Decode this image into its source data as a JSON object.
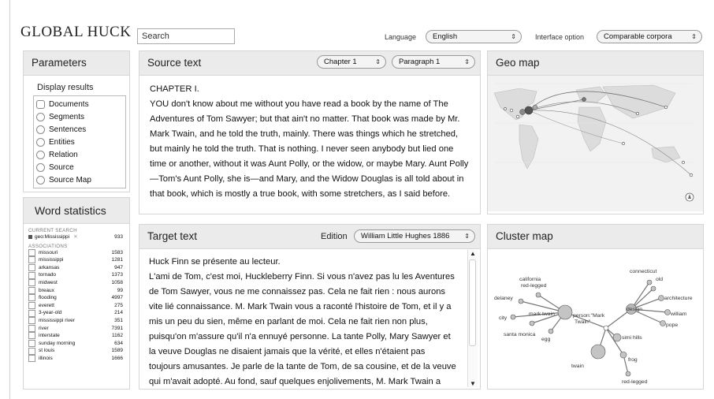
{
  "app": {
    "title": "GLOBAL HUCK"
  },
  "search": {
    "value": "Search"
  },
  "language": {
    "label": "Language",
    "value": "English"
  },
  "interface": {
    "label": "Interface option",
    "value": "Comparable corpora"
  },
  "parameters": {
    "title": "Parameters",
    "display_label": "Display results",
    "options": [
      "Documents",
      "Segments",
      "Sentences",
      "Entities",
      "Relation",
      "Source",
      "Source Map"
    ]
  },
  "word_stats": {
    "title": "Word statistics",
    "current_label": "CURRENT SEARCH",
    "current": {
      "term": "geo:Mississippi",
      "count": "933"
    },
    "assoc_label": "ASSOCIATIONS",
    "rows": [
      {
        "term": "missouri",
        "count": "1583"
      },
      {
        "term": "mississippi",
        "count": "1281"
      },
      {
        "term": "arkansas",
        "count": "947"
      },
      {
        "term": "tornado",
        "count": "1373"
      },
      {
        "term": "midwest",
        "count": "1058"
      },
      {
        "term": "breaux",
        "count": "99"
      },
      {
        "term": "flooding",
        "count": "4997"
      },
      {
        "term": "everett",
        "count": "275"
      },
      {
        "term": "3-year-old",
        "count": "214"
      },
      {
        "term": "mississippi river",
        "count": "351"
      },
      {
        "term": "river",
        "count": "7391"
      },
      {
        "term": "interstate",
        "count": "1162"
      },
      {
        "term": "sunday morning",
        "count": "634"
      },
      {
        "term": "st louis",
        "count": "1589"
      },
      {
        "term": "illinois",
        "count": "1666"
      }
    ]
  },
  "source": {
    "title": "Source text",
    "chapter": "Chapter 1",
    "paragraph": "Paragraph 1",
    "heading": "CHAPTER I.",
    "text": "YOU don't know about me without you have read a book by the name of The Adventures of Tom Sawyer; but that ain't no matter. That book was made by Mr. Mark Twain, and he told the truth, mainly. There was things which he stretched, but mainly he told the truth. That is nothing. I never seen anybody but lied one time or another, without it was Aunt Polly, or the widow, or maybe Mary. Aunt Polly—Tom's Aunt Polly, she is—and Mary, and the Widow Douglas is all told about in that book, which is mostly a true book, with some stretchers, as I said before."
  },
  "target": {
    "title": "Target text",
    "edition_label": "Edition",
    "edition": "William Little Hughes 1886",
    "heading": "Huck Finn se présente au lecteur.",
    "text": "L'ami de Tom, c'est moi, Huckleberry Finn. Si vous n'avez pas lu les Aventures de Tom Sawyer, vous ne me connaissez pas. Cela ne fait rien : nous aurons vite lié connaissance. M. Mark Twain vous a raconté l'histoire de Tom, et il y a mis un peu du sien, même en parlant de moi. Cela ne fait rien non plus, puisqu'on m'assure qu'il n'a ennuyé personne. La tante Polly, Mary Sawyer et la veuve Douglas ne disaient jamais que la vérité, et elles n'étaient pas toujours amusantes. Je parle de la tante de Tom, de sa cousine, et de la veuve qui m'avait adopté. Au fond, sauf quelques enjolivements, M. Mark Twain a rapporté les faits tels qu'ils se sont passés. Pour ma part, je n'"
  },
  "geo": {
    "title": "Geo map"
  },
  "cluster": {
    "title": "Cluster map",
    "labels": [
      "connecticut",
      "california red-legged",
      "old",
      "architecture",
      "delaney",
      "design",
      "mark twain",
      "person:\"Mark Twain\"",
      "william",
      "city",
      "pope",
      "simi hills",
      "santa monica",
      "egg",
      "twain",
      "frog",
      "red-legged"
    ]
  },
  "icons": {
    "dropdown": "updown-arrow-icon",
    "scroll_up": "triangle-up-icon",
    "scroll_down": "triangle-down-icon",
    "remove": "close-x-icon"
  }
}
